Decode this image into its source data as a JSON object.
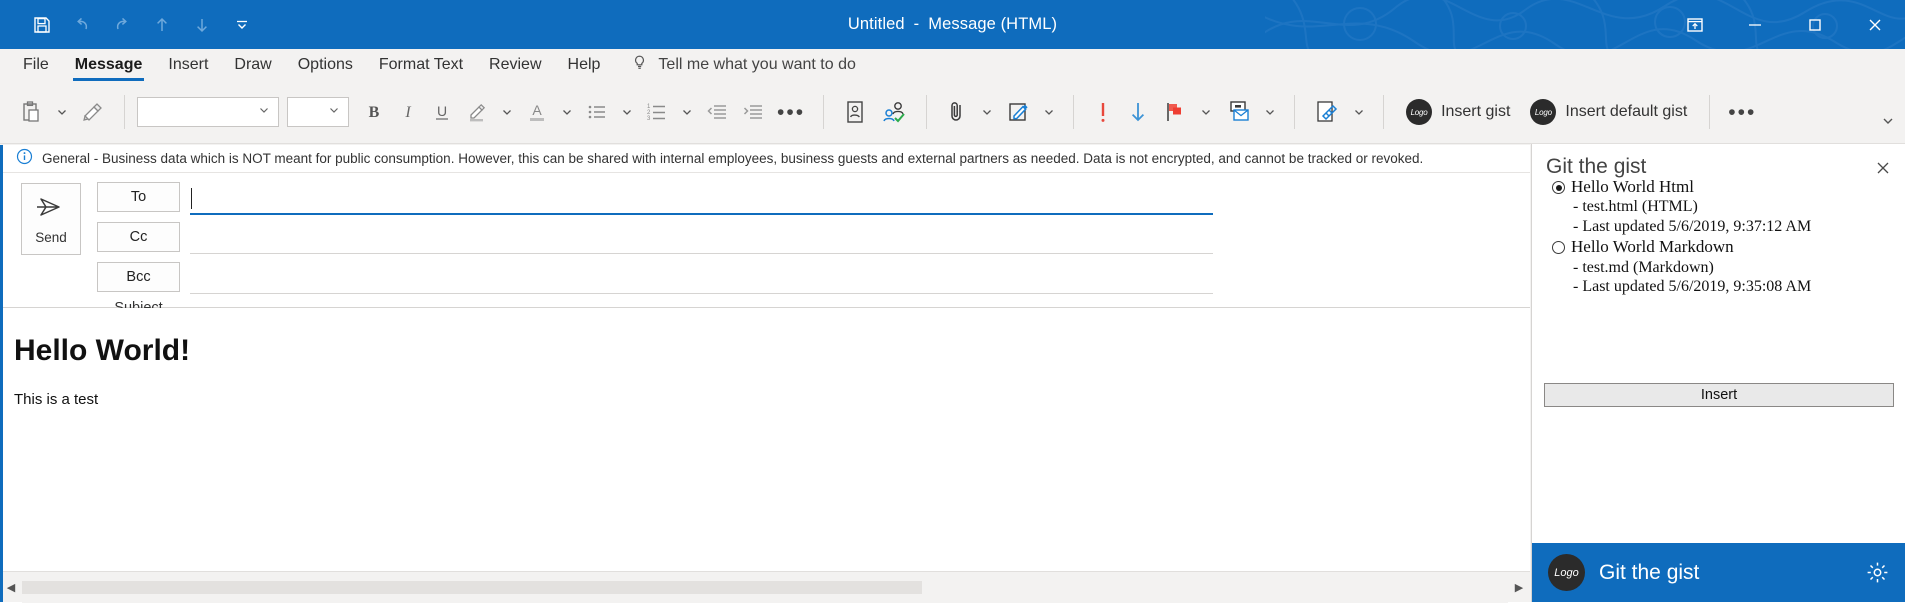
{
  "window": {
    "title_main": "Untitled",
    "title_sep": "-",
    "title_doc": "Message (HTML)",
    "accent": "#0f6cbd",
    "controls": [
      {
        "name": "ribbon-display-options",
        "glyph": "ribbon"
      },
      {
        "name": "minimize",
        "glyph": "minimize"
      },
      {
        "name": "maximize",
        "glyph": "maximize"
      },
      {
        "name": "close",
        "glyph": "close"
      }
    ]
  },
  "quick_access": [
    {
      "name": "save-icon",
      "label": "Save",
      "enabled": true
    },
    {
      "name": "undo-icon",
      "label": "Undo",
      "enabled": false
    },
    {
      "name": "redo-icon",
      "label": "Redo",
      "enabled": false
    },
    {
      "name": "previous-item-icon",
      "label": "Previous Item",
      "enabled": false
    },
    {
      "name": "next-item-icon",
      "label": "Next Item",
      "enabled": false
    },
    {
      "name": "customize-quick-access-toolbar-icon",
      "label": "Customize Quick Access Toolbar",
      "enabled": true
    }
  ],
  "ribbon_tabs": [
    {
      "label": "File",
      "active": false
    },
    {
      "label": "Message",
      "active": true
    },
    {
      "label": "Insert",
      "active": false
    },
    {
      "label": "Draw",
      "active": false
    },
    {
      "label": "Options",
      "active": false
    },
    {
      "label": "Format Text",
      "active": false
    },
    {
      "label": "Review",
      "active": false
    },
    {
      "label": "Help",
      "active": false
    }
  ],
  "tell_me": {
    "label": "Tell me what you want to do",
    "icon": "lightbulb-icon"
  },
  "ribbon": {
    "font_name": "",
    "font_name_placeholder": "",
    "font_size": "",
    "font_size_placeholder": "",
    "insert_gist_label": "Insert gist",
    "insert_default_gist_label": "Insert default gist",
    "addin_logo_text": "Logo",
    "overflow_label": "•••",
    "paragraph_more_label": "•••"
  },
  "banner": {
    "icon": "info-icon",
    "text": "General - Business data which is NOT meant for public consumption. However, this can be shared with internal employees, business guests and external partners as needed. Data is not encrypted, and cannot be tracked or revoked."
  },
  "compose": {
    "send_label": "Send",
    "to_label": "To",
    "cc_label": "Cc",
    "bcc_label": "Bcc",
    "subject_label": "Subject",
    "to_value": "",
    "cc_value": "",
    "bcc_value": "",
    "subject_value": ""
  },
  "body": {
    "heading": "Hello World!",
    "paragraph": "This is a test"
  },
  "task_pane": {
    "title": "Git the gist",
    "close_label": "✕",
    "insert_button": "Insert",
    "footer_title": "Git the gist",
    "footer_logo_text": "Logo",
    "footer_gear": "settings-icon",
    "gists": [
      {
        "name": "Hello World Html",
        "file": "- test.html (HTML)",
        "updated": "- Last updated 5/6/2019, 9:37:12 AM",
        "selected": true
      },
      {
        "name": "Hello World Markdown",
        "file": "- test.md (Markdown)",
        "updated": "- Last updated 5/6/2019, 9:35:08 AM",
        "selected": false
      }
    ]
  }
}
